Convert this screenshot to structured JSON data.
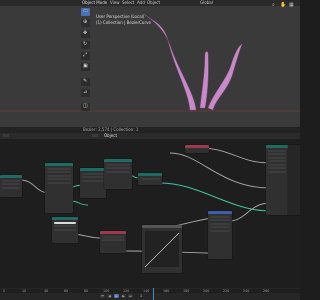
{
  "viewport": {
    "mode": "Object Mode",
    "menu": [
      "View",
      "Select",
      "Add",
      "Object"
    ],
    "transform_orientation": "Global",
    "perspective": "User Perspective (Local)",
    "collection": "(1) Collection | BezierCurve",
    "status": "Bezier: 2,574 | Collection: 1"
  },
  "node_editor": {
    "object_label": "Object"
  },
  "timeline": {
    "ticks": [
      "0",
      "10",
      "40",
      "60",
      "80",
      "100",
      "120",
      "140",
      "160",
      "180",
      "200",
      "220",
      "240",
      "260"
    ],
    "current_frame": "1"
  },
  "colors": {
    "accent": "#4772b3",
    "tentacle": "#c889c9",
    "link_green": "#3fc3a3",
    "link_gray": "#a8a8a8",
    "node_header_red": "#9e3a4e",
    "node_header_teal": "#1e6b63",
    "node_header_blue": "#3b5ea8",
    "node_header_gray": "#555555"
  },
  "icons": [
    "select-box-icon",
    "cursor-icon",
    "move-icon",
    "rotate-icon",
    "scale-icon",
    "transform-icon",
    "annotate-icon",
    "measure-icon",
    "add-cube-icon",
    "camera-icon",
    "hand-icon",
    "grid-icon",
    "play-icon"
  ]
}
